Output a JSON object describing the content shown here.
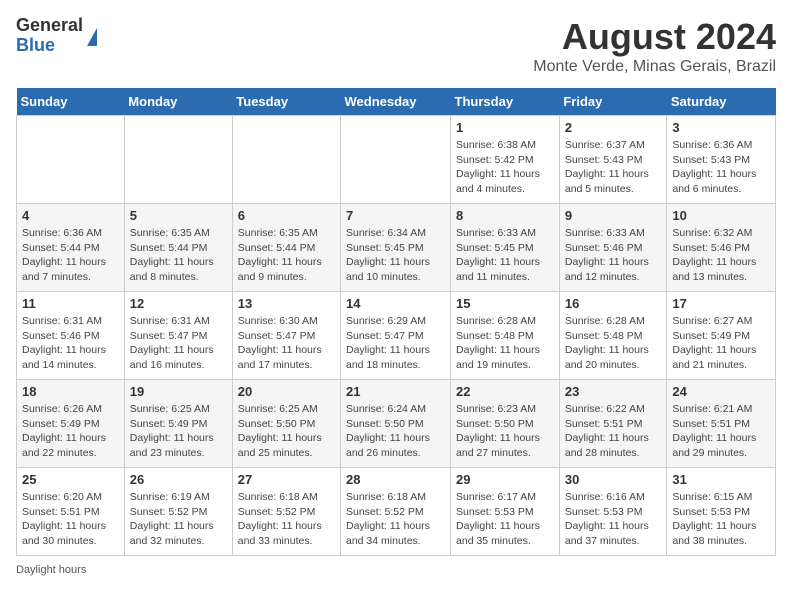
{
  "logo": {
    "general": "General",
    "blue": "Blue"
  },
  "title": "August 2024",
  "location": "Monte Verde, Minas Gerais, Brazil",
  "days_of_week": [
    "Sunday",
    "Monday",
    "Tuesday",
    "Wednesday",
    "Thursday",
    "Friday",
    "Saturday"
  ],
  "footer": "Daylight hours",
  "weeks": [
    [
      {
        "day": "",
        "info": ""
      },
      {
        "day": "",
        "info": ""
      },
      {
        "day": "",
        "info": ""
      },
      {
        "day": "",
        "info": ""
      },
      {
        "day": "1",
        "info": "Sunrise: 6:38 AM\nSunset: 5:42 PM\nDaylight: 11 hours and 4 minutes."
      },
      {
        "day": "2",
        "info": "Sunrise: 6:37 AM\nSunset: 5:43 PM\nDaylight: 11 hours and 5 minutes."
      },
      {
        "day": "3",
        "info": "Sunrise: 6:36 AM\nSunset: 5:43 PM\nDaylight: 11 hours and 6 minutes."
      }
    ],
    [
      {
        "day": "4",
        "info": "Sunrise: 6:36 AM\nSunset: 5:44 PM\nDaylight: 11 hours and 7 minutes."
      },
      {
        "day": "5",
        "info": "Sunrise: 6:35 AM\nSunset: 5:44 PM\nDaylight: 11 hours and 8 minutes."
      },
      {
        "day": "6",
        "info": "Sunrise: 6:35 AM\nSunset: 5:44 PM\nDaylight: 11 hours and 9 minutes."
      },
      {
        "day": "7",
        "info": "Sunrise: 6:34 AM\nSunset: 5:45 PM\nDaylight: 11 hours and 10 minutes."
      },
      {
        "day": "8",
        "info": "Sunrise: 6:33 AM\nSunset: 5:45 PM\nDaylight: 11 hours and 11 minutes."
      },
      {
        "day": "9",
        "info": "Sunrise: 6:33 AM\nSunset: 5:46 PM\nDaylight: 11 hours and 12 minutes."
      },
      {
        "day": "10",
        "info": "Sunrise: 6:32 AM\nSunset: 5:46 PM\nDaylight: 11 hours and 13 minutes."
      }
    ],
    [
      {
        "day": "11",
        "info": "Sunrise: 6:31 AM\nSunset: 5:46 PM\nDaylight: 11 hours and 14 minutes."
      },
      {
        "day": "12",
        "info": "Sunrise: 6:31 AM\nSunset: 5:47 PM\nDaylight: 11 hours and 16 minutes."
      },
      {
        "day": "13",
        "info": "Sunrise: 6:30 AM\nSunset: 5:47 PM\nDaylight: 11 hours and 17 minutes."
      },
      {
        "day": "14",
        "info": "Sunrise: 6:29 AM\nSunset: 5:47 PM\nDaylight: 11 hours and 18 minutes."
      },
      {
        "day": "15",
        "info": "Sunrise: 6:28 AM\nSunset: 5:48 PM\nDaylight: 11 hours and 19 minutes."
      },
      {
        "day": "16",
        "info": "Sunrise: 6:28 AM\nSunset: 5:48 PM\nDaylight: 11 hours and 20 minutes."
      },
      {
        "day": "17",
        "info": "Sunrise: 6:27 AM\nSunset: 5:49 PM\nDaylight: 11 hours and 21 minutes."
      }
    ],
    [
      {
        "day": "18",
        "info": "Sunrise: 6:26 AM\nSunset: 5:49 PM\nDaylight: 11 hours and 22 minutes."
      },
      {
        "day": "19",
        "info": "Sunrise: 6:25 AM\nSunset: 5:49 PM\nDaylight: 11 hours and 23 minutes."
      },
      {
        "day": "20",
        "info": "Sunrise: 6:25 AM\nSunset: 5:50 PM\nDaylight: 11 hours and 25 minutes."
      },
      {
        "day": "21",
        "info": "Sunrise: 6:24 AM\nSunset: 5:50 PM\nDaylight: 11 hours and 26 minutes."
      },
      {
        "day": "22",
        "info": "Sunrise: 6:23 AM\nSunset: 5:50 PM\nDaylight: 11 hours and 27 minutes."
      },
      {
        "day": "23",
        "info": "Sunrise: 6:22 AM\nSunset: 5:51 PM\nDaylight: 11 hours and 28 minutes."
      },
      {
        "day": "24",
        "info": "Sunrise: 6:21 AM\nSunset: 5:51 PM\nDaylight: 11 hours and 29 minutes."
      }
    ],
    [
      {
        "day": "25",
        "info": "Sunrise: 6:20 AM\nSunset: 5:51 PM\nDaylight: 11 hours and 30 minutes."
      },
      {
        "day": "26",
        "info": "Sunrise: 6:19 AM\nSunset: 5:52 PM\nDaylight: 11 hours and 32 minutes."
      },
      {
        "day": "27",
        "info": "Sunrise: 6:18 AM\nSunset: 5:52 PM\nDaylight: 11 hours and 33 minutes."
      },
      {
        "day": "28",
        "info": "Sunrise: 6:18 AM\nSunset: 5:52 PM\nDaylight: 11 hours and 34 minutes."
      },
      {
        "day": "29",
        "info": "Sunrise: 6:17 AM\nSunset: 5:53 PM\nDaylight: 11 hours and 35 minutes."
      },
      {
        "day": "30",
        "info": "Sunrise: 6:16 AM\nSunset: 5:53 PM\nDaylight: 11 hours and 37 minutes."
      },
      {
        "day": "31",
        "info": "Sunrise: 6:15 AM\nSunset: 5:53 PM\nDaylight: 11 hours and 38 minutes."
      }
    ]
  ]
}
